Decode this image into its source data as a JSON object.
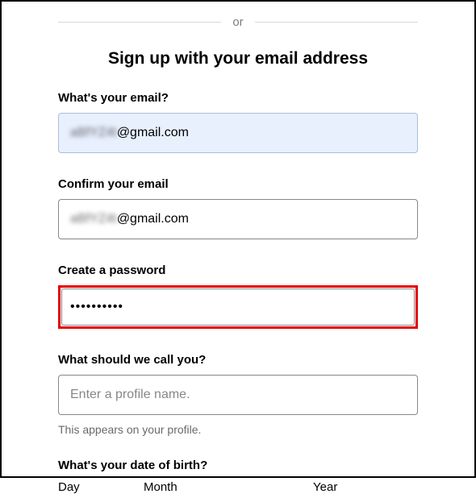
{
  "divider_text": "or",
  "heading": "Sign up with your email address",
  "email": {
    "label": "What's your email?",
    "prefix_masked": "aBfYZ4t",
    "domain": "@gmail.com"
  },
  "confirm_email": {
    "label": "Confirm your email",
    "prefix_masked": "aBfYZ4t",
    "domain": "@gmail.com"
  },
  "password": {
    "label": "Create a password",
    "value": "••••••••••"
  },
  "profile_name": {
    "label": "What should we call you?",
    "placeholder": "Enter a profile name.",
    "helper": "This appears on your profile."
  },
  "dob": {
    "label": "What's your date of birth?",
    "day_label": "Day",
    "month_label": "Month",
    "year_label": "Year"
  }
}
